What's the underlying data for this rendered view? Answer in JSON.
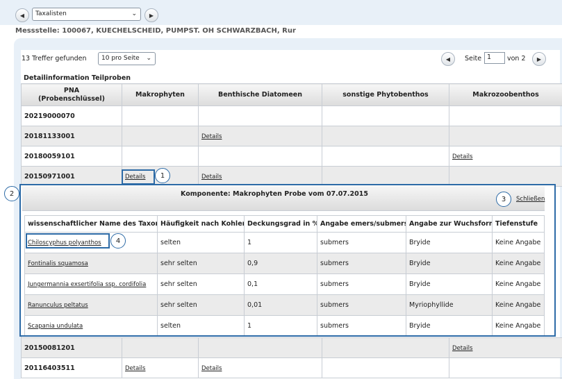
{
  "toolbar": {
    "dropdown_value": "Taxalisten",
    "prev": "◀",
    "next": "▶"
  },
  "station": "Messstelle: 100067, KUECHELSCHEID, PUMPST. OH SCHWARZBACH, Rur",
  "results": {
    "count_text": "13 Treffer gefunden",
    "per_page": "10 pro Seite",
    "page_label": "Seite",
    "page_value": "1",
    "page_of": "von 2",
    "section_title": "Detailinformation Teilproben"
  },
  "main_table": {
    "headers": [
      "PNA\n(Probenschlüssel)",
      "Makrophyten",
      "Benthische Diatomeen",
      "sonstige Phytobenthos",
      "Makrozoobenthos"
    ],
    "header_pna_line1": "PNA",
    "header_pna_line2": "(Probenschlüssel)",
    "rows": [
      {
        "pna": "20219000070",
        "c1": "",
        "c2": "",
        "c3": "",
        "c4": ""
      },
      {
        "pna": "20181133001",
        "c1": "",
        "c2": "Details",
        "c3": "",
        "c4": ""
      },
      {
        "pna": "20180059101",
        "c1": "",
        "c2": "",
        "c3": "",
        "c4": "Details"
      },
      {
        "pna": "20150971001",
        "c1": "Details",
        "c2": "Details",
        "c3": "",
        "c4": ""
      },
      {
        "pna": "20150081201",
        "c1": "",
        "c2": "",
        "c3": "",
        "c4": "Details"
      },
      {
        "pna": "20116403511",
        "c1": "Details",
        "c2": "Details",
        "c3": "",
        "c4": ""
      }
    ]
  },
  "detail": {
    "title": "Komponente: Makrophyten  Probe vom    07.07.2015",
    "close": "Schließen",
    "headers": [
      "wissenschaftlicher Name des Taxons",
      "Häufigkeit nach Kohler",
      "Deckungsgrad in %",
      "Angabe emers/submers",
      "Angabe zur Wuchsform",
      "Tiefenstufe"
    ],
    "rows": [
      [
        "Chiloscyphus polyanthos",
        "selten",
        "1",
        "submers",
        "Bryide",
        "Keine Angabe"
      ],
      [
        "Fontinalis squamosa",
        "sehr selten",
        "0,9",
        "submers",
        "Bryide",
        "Keine Angabe"
      ],
      [
        "Jungermannia exsertifolia ssp. cordifolia",
        "sehr selten",
        "0,1",
        "submers",
        "Bryide",
        "Keine Angabe"
      ],
      [
        "Ranunculus peltatus",
        "sehr selten",
        "0,01",
        "submers",
        "Myriophyllide",
        "Keine Angabe"
      ],
      [
        "Scapania undulata",
        "selten",
        "1",
        "submers",
        "Bryide",
        "Keine Angabe"
      ]
    ]
  },
  "callouts": [
    "1",
    "2",
    "3",
    "4"
  ]
}
